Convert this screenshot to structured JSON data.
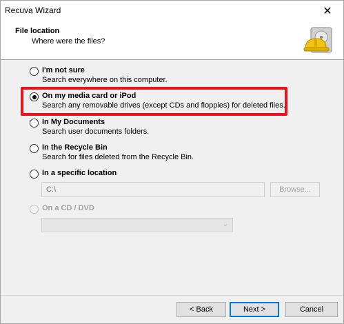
{
  "window": {
    "title": "Recuva Wizard",
    "close_glyph": "✕"
  },
  "header": {
    "title": "File location",
    "subtitle": "Where were the files?",
    "logo_icon": "hard-drive-hardhat-icon"
  },
  "options": [
    {
      "label": "I'm not sure",
      "desc": "Search everywhere on this computer.",
      "checked": false,
      "disabled": false
    },
    {
      "label": "On my media card or iPod",
      "desc": "Search any removable drives (except CDs and floppies) for deleted files.",
      "checked": true,
      "disabled": false
    },
    {
      "label": "In My Documents",
      "desc": "Search user documents folders.",
      "checked": false,
      "disabled": false
    },
    {
      "label": "In the Recycle Bin",
      "desc": "Search for files deleted from the Recycle Bin.",
      "checked": false,
      "disabled": false
    },
    {
      "label": "In a specific location",
      "desc": "",
      "checked": false,
      "disabled": false
    },
    {
      "label": "On a CD / DVD",
      "desc": "",
      "checked": false,
      "disabled": true
    }
  ],
  "location": {
    "path_value": "C:\\",
    "browse_label": "Browse..."
  },
  "cd_select": {
    "selected": "",
    "chevron": "⌄"
  },
  "footer": {
    "back_label": "< Back",
    "next_label": "Next >",
    "cancel_label": "Cancel"
  },
  "colors": {
    "highlight": "#e8141b",
    "primary_border": "#0078d7"
  }
}
